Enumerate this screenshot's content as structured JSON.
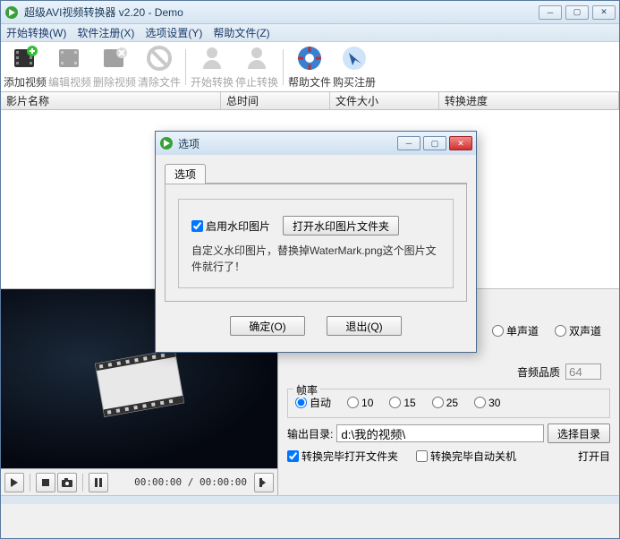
{
  "window": {
    "title": "超级AVI视频转换器 v2.20 - Demo"
  },
  "menu": {
    "start": "开始转换(W)",
    "register": "软件注册(X)",
    "options": "选项设置(Y)",
    "help": "帮助文件(Z)"
  },
  "toolbar": {
    "add": "添加视频",
    "edit": "编辑视频",
    "delete": "删除视频",
    "clear": "清除文件",
    "start": "开始转换",
    "stop": "停止转换",
    "helpfile": "帮助文件",
    "buy": "购买注册"
  },
  "columns": {
    "name": "影片名称",
    "duration": "总时间",
    "size": "文件大小",
    "progress": "转换进度"
  },
  "preview": {
    "time": "00:00:00 / 00:00:00"
  },
  "channels": {
    "mono": "单声道",
    "stereo": "双声道"
  },
  "audio_quality": {
    "label": "音频品质",
    "value": "64"
  },
  "framerate": {
    "label": "帧率",
    "auto": "自动",
    "r10": "10",
    "r15": "15",
    "r25": "25",
    "r30": "30"
  },
  "output": {
    "label": "输出目录:",
    "path": "d:\\我的视频\\",
    "browse": "选择目录"
  },
  "checks": {
    "open_after": "转换完毕打开文件夹",
    "shutdown": "转换完毕自动关机",
    "open_dir": "打开目"
  },
  "dialog": {
    "title": "选项",
    "tab": "选项",
    "enable_watermark": "启用水印图片",
    "open_wm_folder": "打开水印图片文件夹",
    "hint": "自定义水印图片，替换掉WaterMark.png这个图片文件就行了！",
    "ok": "确定(O)",
    "cancel": "退出(Q)"
  }
}
